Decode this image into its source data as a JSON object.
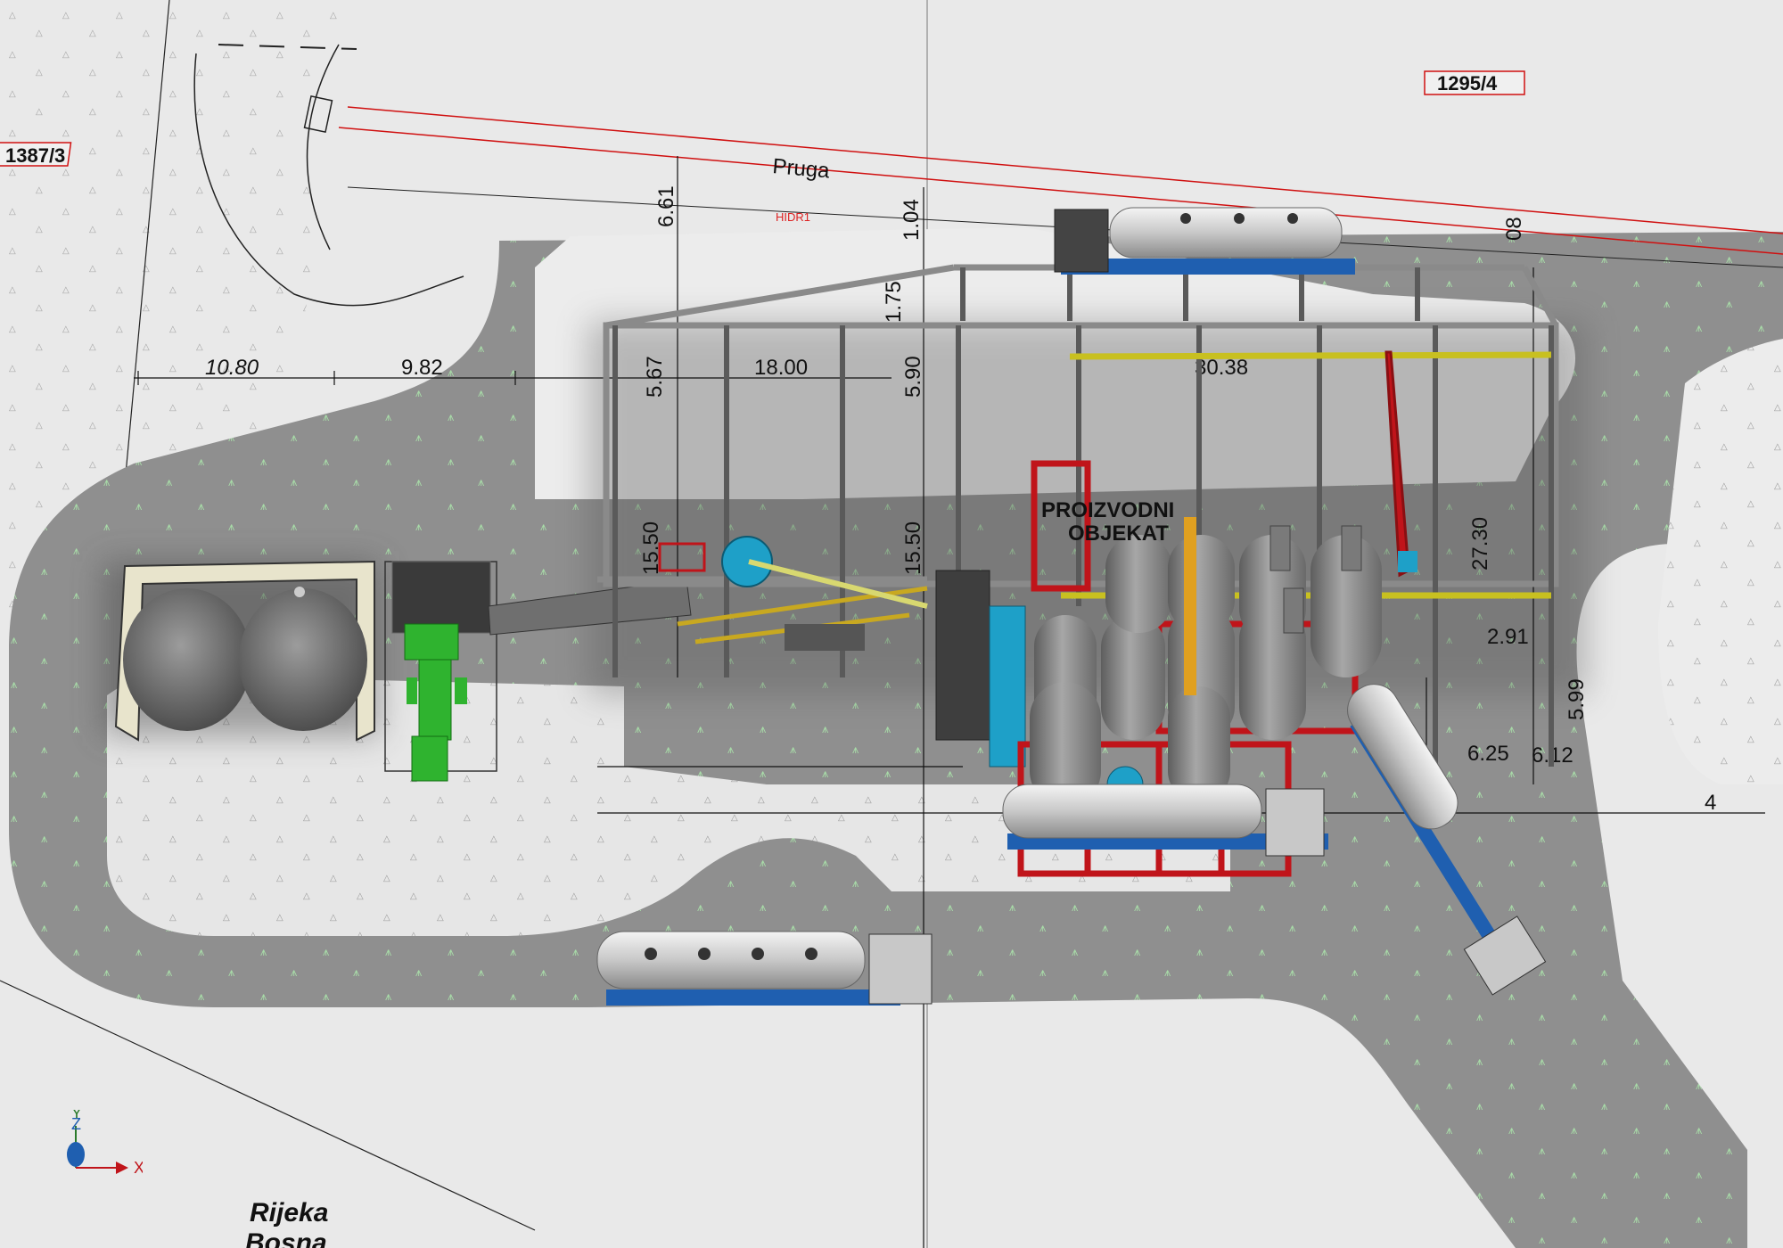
{
  "scene": {
    "parcels": [
      "1387/3",
      "1295/4"
    ],
    "rail_label": "Pruga",
    "hydrant_label": "HIDR1",
    "building_label_line1": "PROIZVODNI",
    "building_label_line2": "OBJEKAT",
    "river_label_line1": "Rijeka",
    "river_label_line2": "Bosna"
  },
  "dimensions": {
    "top_left": "10.80",
    "top_mid": "9.82",
    "d661": "6.61",
    "d104": "1.04",
    "d175": "1.75",
    "d567": "5.67",
    "d1800": "18.00",
    "d590": "5.90",
    "d3038": "30.38",
    "d1550a": "15.50",
    "d1550b": "15.50",
    "d2730": "27.30",
    "d291": "2.91",
    "d625": "6.25",
    "d08": "08",
    "d612": "6.12",
    "d599": "5.99",
    "d4": "4"
  },
  "axis_triad": {
    "x": "X",
    "y": "Y",
    "z": "Z"
  },
  "colors": {
    "road": "#8c8c8c",
    "ground": "#e6e6e6",
    "steel": "#555555",
    "tank": "#8d8d8d",
    "support_red": "#c0141a",
    "loader_green": "#2fb32f",
    "tanker_blue": "#1f5fb0",
    "pipe_yellow": "#c8c020",
    "parcel_red": "#d01010"
  }
}
